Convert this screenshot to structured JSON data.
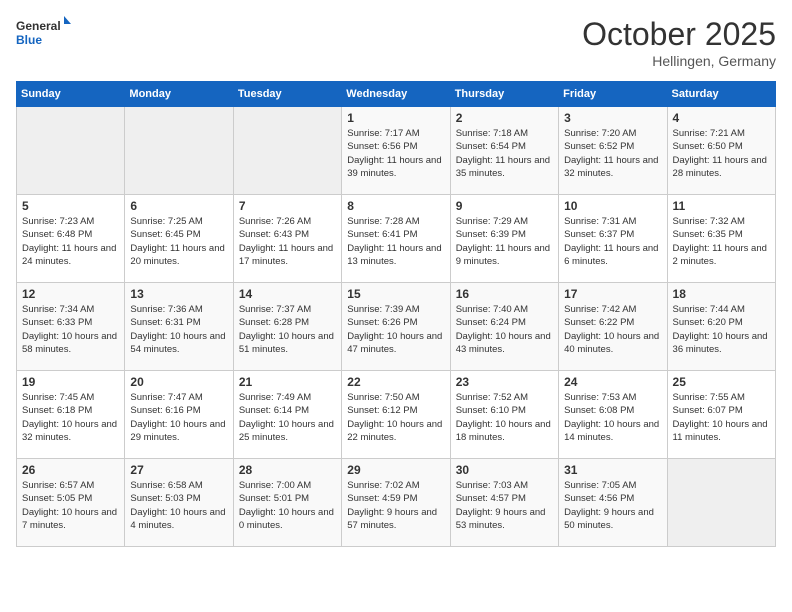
{
  "logo": {
    "line1": "General",
    "line2": "Blue"
  },
  "title": "October 2025",
  "location": "Hellingen, Germany",
  "days_of_week": [
    "Sunday",
    "Monday",
    "Tuesday",
    "Wednesday",
    "Thursday",
    "Friday",
    "Saturday"
  ],
  "weeks": [
    [
      {
        "day": "",
        "info": ""
      },
      {
        "day": "",
        "info": ""
      },
      {
        "day": "",
        "info": ""
      },
      {
        "day": "1",
        "info": "Sunrise: 7:17 AM\nSunset: 6:56 PM\nDaylight: 11 hours and 39 minutes."
      },
      {
        "day": "2",
        "info": "Sunrise: 7:18 AM\nSunset: 6:54 PM\nDaylight: 11 hours and 35 minutes."
      },
      {
        "day": "3",
        "info": "Sunrise: 7:20 AM\nSunset: 6:52 PM\nDaylight: 11 hours and 32 minutes."
      },
      {
        "day": "4",
        "info": "Sunrise: 7:21 AM\nSunset: 6:50 PM\nDaylight: 11 hours and 28 minutes."
      }
    ],
    [
      {
        "day": "5",
        "info": "Sunrise: 7:23 AM\nSunset: 6:48 PM\nDaylight: 11 hours and 24 minutes."
      },
      {
        "day": "6",
        "info": "Sunrise: 7:25 AM\nSunset: 6:45 PM\nDaylight: 11 hours and 20 minutes."
      },
      {
        "day": "7",
        "info": "Sunrise: 7:26 AM\nSunset: 6:43 PM\nDaylight: 11 hours and 17 minutes."
      },
      {
        "day": "8",
        "info": "Sunrise: 7:28 AM\nSunset: 6:41 PM\nDaylight: 11 hours and 13 minutes."
      },
      {
        "day": "9",
        "info": "Sunrise: 7:29 AM\nSunset: 6:39 PM\nDaylight: 11 hours and 9 minutes."
      },
      {
        "day": "10",
        "info": "Sunrise: 7:31 AM\nSunset: 6:37 PM\nDaylight: 11 hours and 6 minutes."
      },
      {
        "day": "11",
        "info": "Sunrise: 7:32 AM\nSunset: 6:35 PM\nDaylight: 11 hours and 2 minutes."
      }
    ],
    [
      {
        "day": "12",
        "info": "Sunrise: 7:34 AM\nSunset: 6:33 PM\nDaylight: 10 hours and 58 minutes."
      },
      {
        "day": "13",
        "info": "Sunrise: 7:36 AM\nSunset: 6:31 PM\nDaylight: 10 hours and 54 minutes."
      },
      {
        "day": "14",
        "info": "Sunrise: 7:37 AM\nSunset: 6:28 PM\nDaylight: 10 hours and 51 minutes."
      },
      {
        "day": "15",
        "info": "Sunrise: 7:39 AM\nSunset: 6:26 PM\nDaylight: 10 hours and 47 minutes."
      },
      {
        "day": "16",
        "info": "Sunrise: 7:40 AM\nSunset: 6:24 PM\nDaylight: 10 hours and 43 minutes."
      },
      {
        "day": "17",
        "info": "Sunrise: 7:42 AM\nSunset: 6:22 PM\nDaylight: 10 hours and 40 minutes."
      },
      {
        "day": "18",
        "info": "Sunrise: 7:44 AM\nSunset: 6:20 PM\nDaylight: 10 hours and 36 minutes."
      }
    ],
    [
      {
        "day": "19",
        "info": "Sunrise: 7:45 AM\nSunset: 6:18 PM\nDaylight: 10 hours and 32 minutes."
      },
      {
        "day": "20",
        "info": "Sunrise: 7:47 AM\nSunset: 6:16 PM\nDaylight: 10 hours and 29 minutes."
      },
      {
        "day": "21",
        "info": "Sunrise: 7:49 AM\nSunset: 6:14 PM\nDaylight: 10 hours and 25 minutes."
      },
      {
        "day": "22",
        "info": "Sunrise: 7:50 AM\nSunset: 6:12 PM\nDaylight: 10 hours and 22 minutes."
      },
      {
        "day": "23",
        "info": "Sunrise: 7:52 AM\nSunset: 6:10 PM\nDaylight: 10 hours and 18 minutes."
      },
      {
        "day": "24",
        "info": "Sunrise: 7:53 AM\nSunset: 6:08 PM\nDaylight: 10 hours and 14 minutes."
      },
      {
        "day": "25",
        "info": "Sunrise: 7:55 AM\nSunset: 6:07 PM\nDaylight: 10 hours and 11 minutes."
      }
    ],
    [
      {
        "day": "26",
        "info": "Sunrise: 6:57 AM\nSunset: 5:05 PM\nDaylight: 10 hours and 7 minutes."
      },
      {
        "day": "27",
        "info": "Sunrise: 6:58 AM\nSunset: 5:03 PM\nDaylight: 10 hours and 4 minutes."
      },
      {
        "day": "28",
        "info": "Sunrise: 7:00 AM\nSunset: 5:01 PM\nDaylight: 10 hours and 0 minutes."
      },
      {
        "day": "29",
        "info": "Sunrise: 7:02 AM\nSunset: 4:59 PM\nDaylight: 9 hours and 57 minutes."
      },
      {
        "day": "30",
        "info": "Sunrise: 7:03 AM\nSunset: 4:57 PM\nDaylight: 9 hours and 53 minutes."
      },
      {
        "day": "31",
        "info": "Sunrise: 7:05 AM\nSunset: 4:56 PM\nDaylight: 9 hours and 50 minutes."
      },
      {
        "day": "",
        "info": ""
      }
    ]
  ]
}
